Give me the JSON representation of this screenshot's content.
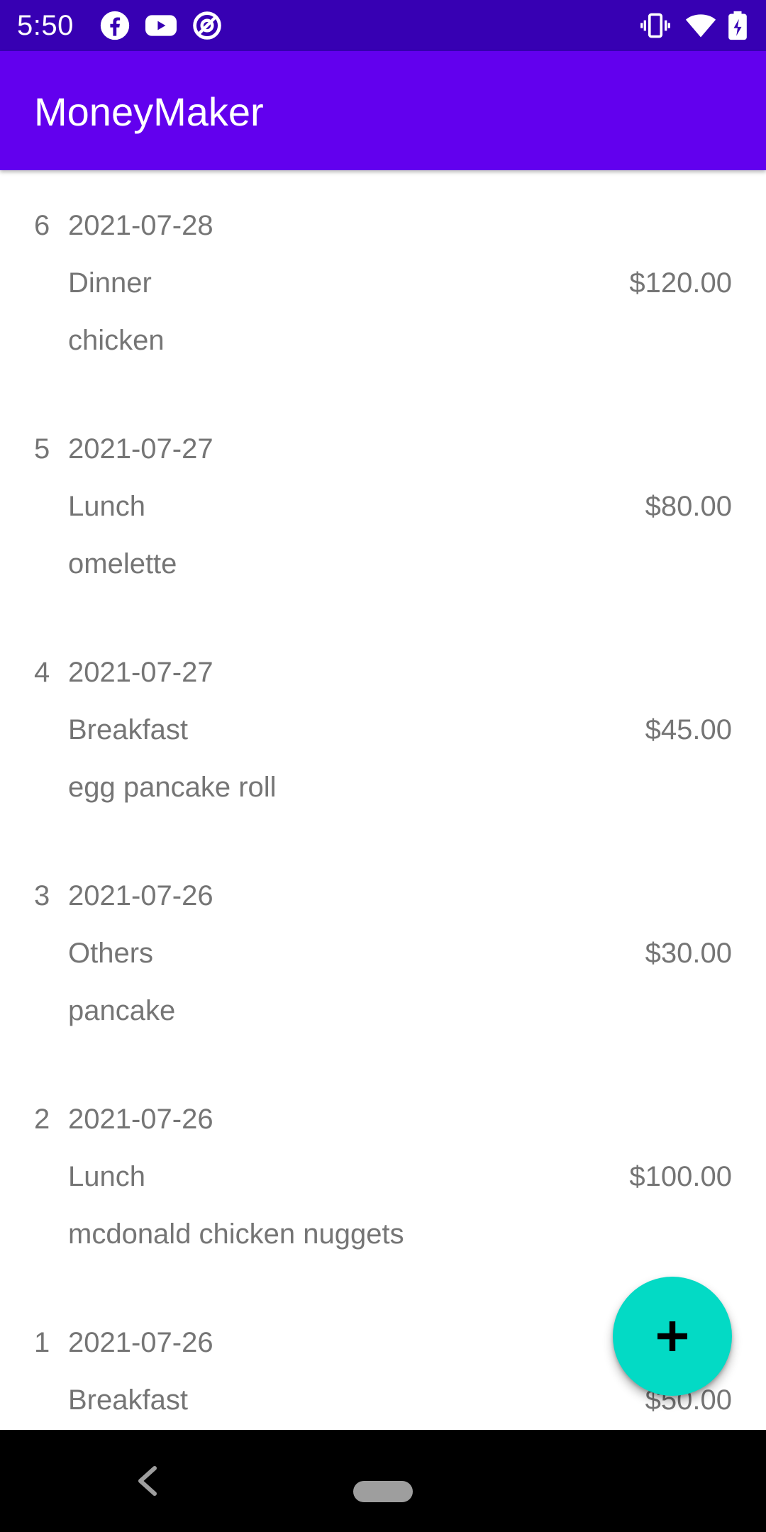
{
  "status_bar": {
    "time": "5:50",
    "left_icons": [
      "facebook-icon",
      "youtube-icon",
      "at-sign-icon"
    ],
    "right_icons": [
      "vibrate-icon",
      "wifi-icon",
      "battery-charging-icon"
    ]
  },
  "app_bar": {
    "title": "MoneyMaker"
  },
  "records": [
    {
      "id": "6",
      "date": "2021-07-28",
      "category": "Dinner",
      "amount": "$120.00",
      "note": "chicken"
    },
    {
      "id": "5",
      "date": "2021-07-27",
      "category": "Lunch",
      "amount": "$80.00",
      "note": "omelette"
    },
    {
      "id": "4",
      "date": "2021-07-27",
      "category": "Breakfast",
      "amount": "$45.00",
      "note": "egg pancake roll"
    },
    {
      "id": "3",
      "date": "2021-07-26",
      "category": "Others",
      "amount": "$30.00",
      "note": "pancake"
    },
    {
      "id": "2",
      "date": "2021-07-26",
      "category": "Lunch",
      "amount": "$100.00",
      "note": "mcdonald chicken nuggets"
    },
    {
      "id": "1",
      "date": "2021-07-26",
      "category": "Breakfast",
      "amount": "$50.00",
      "note": ""
    }
  ],
  "fab": {
    "icon": "plus-icon"
  },
  "nav_bar": {
    "icons": [
      "back-icon",
      "home-pill"
    ]
  },
  "colors": {
    "status_bar": "#3700b3",
    "app_bar": "#6200ee",
    "fab": "#03dac5",
    "record_text": "#757575"
  }
}
